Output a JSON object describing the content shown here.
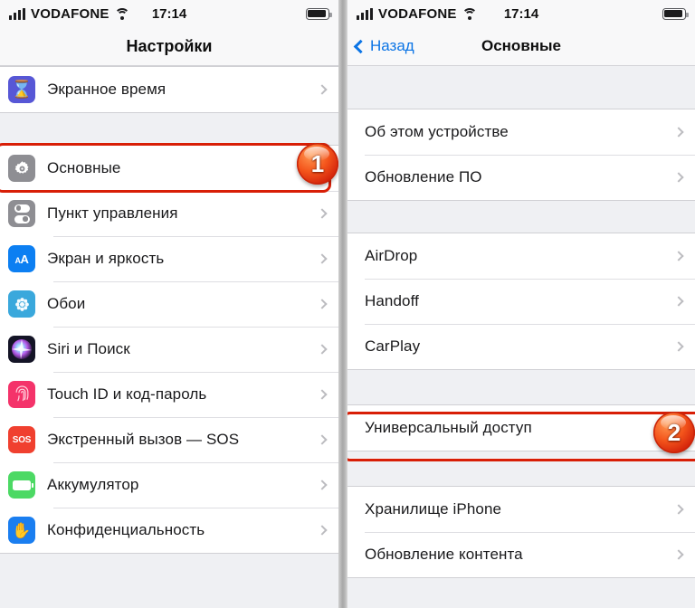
{
  "left": {
    "status": {
      "carrier": "VODAFONE",
      "time": "17:14",
      "signal_icon": "signal-bars-icon",
      "wifi_icon": "wifi-icon",
      "battery_icon": "battery-icon"
    },
    "nav": {
      "title": "Настройки"
    },
    "rows_top": [
      {
        "label": "Экранное время",
        "icon": "hourglass-icon",
        "color": "#5757d6"
      }
    ],
    "rows_main": [
      {
        "label": "Основные",
        "icon": "gear-icon",
        "color": "#8e8e93"
      },
      {
        "label": "Пункт управления",
        "icon": "toggles-icon",
        "color": "#8e8e93"
      },
      {
        "label": "Экран и яркость",
        "icon": "text-size-icon",
        "color": "#0c7ff2"
      },
      {
        "label": "Обои",
        "icon": "flower-icon",
        "color": "#3aa8dc"
      },
      {
        "label": "Siri и Поиск",
        "icon": "siri-icon",
        "color": "#1c1c2e"
      },
      {
        "label": "Touch ID и код-пароль",
        "icon": "fingerprint-icon",
        "color": "#f4336a"
      },
      {
        "label": "Экстренный вызов — SOS",
        "icon": "sos-icon",
        "color": "#f0402f"
      },
      {
        "label": "Аккумулятор",
        "icon": "battery-icon",
        "color": "#4cd964"
      },
      {
        "label": "Конфиденциальность",
        "icon": "hand-icon",
        "color": "#1a7ef0"
      }
    ],
    "highlight": {
      "target": "Основные",
      "badge": "1",
      "color": "#d81e06"
    }
  },
  "right": {
    "status": {
      "carrier": "VODAFONE",
      "time": "17:14",
      "signal_icon": "signal-bars-icon",
      "wifi_icon": "wifi-icon",
      "battery_icon": "battery-icon"
    },
    "nav": {
      "back_label": "Назад",
      "back_icon": "chevron-left-icon",
      "title": "Основные"
    },
    "group_1": [
      {
        "label": "Об этом устройстве"
      },
      {
        "label": "Обновление ПО"
      }
    ],
    "group_2": [
      {
        "label": "AirDrop"
      },
      {
        "label": "Handoff"
      },
      {
        "label": "CarPlay"
      }
    ],
    "group_3": [
      {
        "label": "Универсальный доступ"
      }
    ],
    "group_4": [
      {
        "label": "Хранилище iPhone"
      },
      {
        "label": "Обновление контента"
      }
    ],
    "highlight": {
      "target": "Универсальный доступ",
      "badge": "2",
      "color": "#d81e06"
    }
  }
}
